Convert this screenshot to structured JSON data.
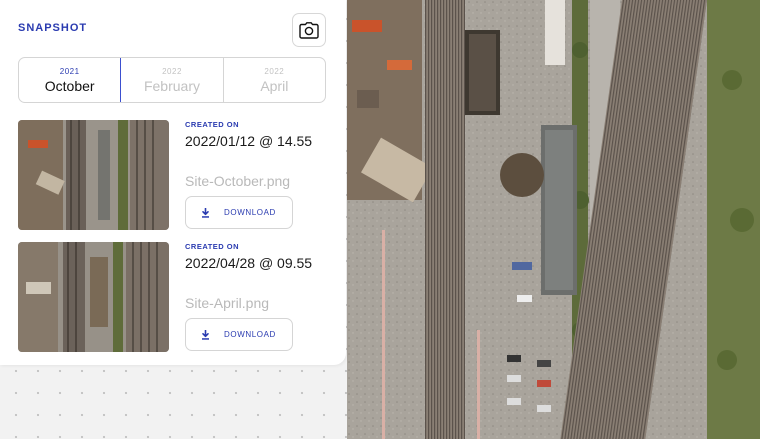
{
  "panel": {
    "title": "SNAPSHOT",
    "camera_icon": "camera-icon"
  },
  "tabs": [
    {
      "year": "2021",
      "month": "October",
      "active": true
    },
    {
      "year": "2022",
      "month": "February",
      "active": false
    },
    {
      "year": "2022",
      "month": "April",
      "active": false
    }
  ],
  "snapshots": [
    {
      "created_label": "CREATED ON",
      "created_date": "2022/01/12 @ 14.55",
      "filename": "Site-October.png",
      "download_label": "DOWNLOAD",
      "download_icon": "download-icon"
    },
    {
      "created_label": "CREATED ON",
      "created_date": "2022/04/28 @ 09.55",
      "filename": "Site-April.png",
      "download_label": "DOWNLOAD",
      "download_icon": "download-icon"
    }
  ],
  "colors": {
    "accent": "#2a3bb0",
    "muted_text": "#b9b9b9"
  }
}
